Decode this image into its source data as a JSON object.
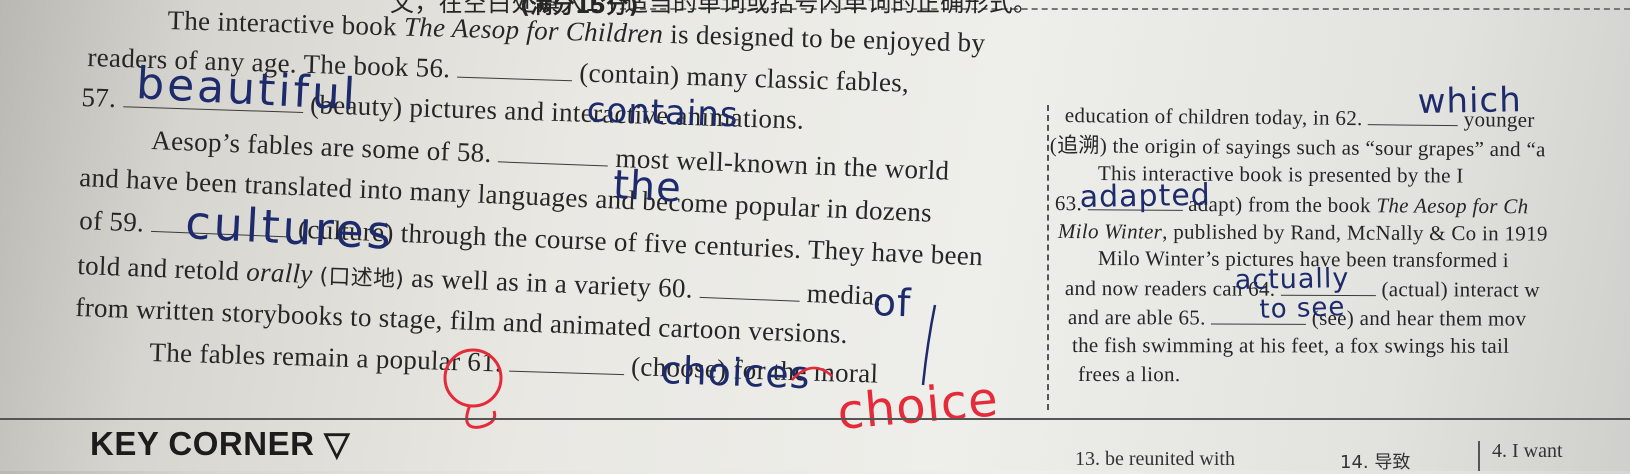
{
  "instruction_fragment": "文，在空白处填入1个适当的单词或括号内单词的正确形式。",
  "score_note": "(满分15分)",
  "left_column": {
    "line1": "The interactive book",
    "line1_title": "The Aesop for Children",
    "line1_end": "is designed to be enjoyed by",
    "line2a": "readers of any age. The book 56.",
    "line2b": "(contain) many classic fables,",
    "line3a": "57.",
    "line3b": "(beauty) pictures and interactive animations.",
    "line4": "Aesop’s fables are some of 58.",
    "line4b": "most well-known in the world",
    "line5": "and have been translated into many languages and become popular in dozens",
    "line6a": "of 59.",
    "line6b": "(culture) through the course of five centuries. They have been",
    "line7a": "told and retold",
    "line7_italic": "orally",
    "line7_cn": "(口述地)",
    "line7b": "as well as in a variety 60.",
    "line7c": "media,",
    "line8": "from written storybooks to stage, film and animated cartoon versions.",
    "line9a": "The fables remain a popular 61.",
    "line9b": "(choose) for the moral"
  },
  "right_column": {
    "line1a": "education of children today, in 62.",
    "line1b": "younger",
    "line2": "(追溯) the origin of sayings such as “sour grapes” and “a",
    "line3": "This interactive book is presented by the I",
    "line4a": "63.",
    "line4b": "adapt) from the book",
    "line4_title": "The Aesop for Ch",
    "line5_author": "Milo Winter",
    "line5b": ", published by Rand, McNally & Co in 1919",
    "line6": "Milo Winter’s pictures have been transformed i",
    "line7a": "and now readers can 64.",
    "line7b": "(actual) interact w",
    "line8a": "and are able 65.",
    "line8b": "(see) and hear them mov",
    "line9": "the fish swimming at his feet, a fox swings his tail",
    "line10": "frees a lion."
  },
  "handwritten_answers": {
    "a56": "contains",
    "a57": "beautiful",
    "a58": "the",
    "a59": "cultures",
    "a60": "of",
    "a61": "choices",
    "a62": "which",
    "a63": "adapted",
    "a64": "actually",
    "a65": "to see",
    "correction": "choice"
  },
  "key_corner": "KEY CORNER ▽",
  "bottom_items": {
    "item13": "13. be reunited with",
    "item14": "14. 导致",
    "item4": "4. I want"
  },
  "colors": {
    "pen_blue": "#1d2a6b",
    "pen_red": "#e52a39",
    "ink": "#262626"
  }
}
